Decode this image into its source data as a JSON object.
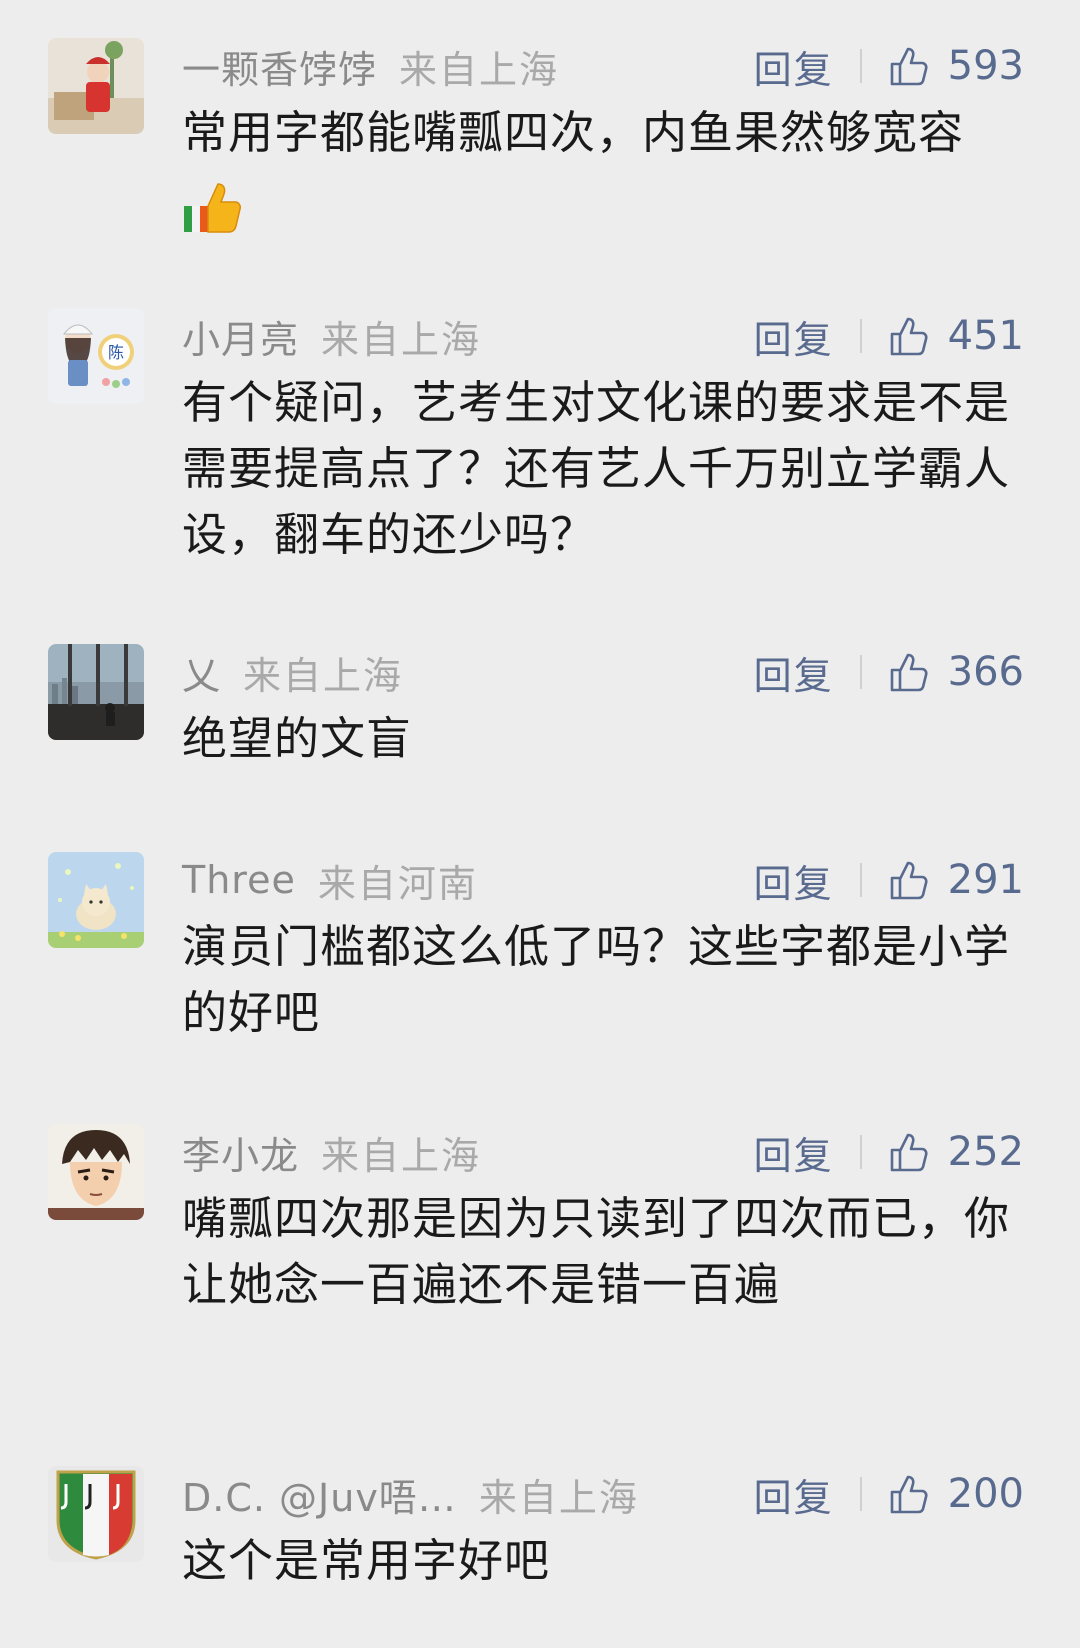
{
  "comments": [
    {
      "username": "一颗香饽饽",
      "location": "来自上海",
      "reply_label": "回复",
      "likes": "593",
      "text": "常用字都能嘴瓢四次，内鱼果然够宽容",
      "emoji": "thumbs-up-emoji"
    },
    {
      "username": "小月亮",
      "location": "来自上海",
      "reply_label": "回复",
      "likes": "451",
      "text": "有个疑问，艺考生对文化课的要求是不是需要提高点了？还有艺人千万别立学霸人设，翻车的还少吗？"
    },
    {
      "username": "乂",
      "location": "来自上海",
      "reply_label": "回复",
      "likes": "366",
      "text": "绝望的文盲"
    },
    {
      "username": "Three",
      "location": "来自河南",
      "reply_label": "回复",
      "likes": "291",
      "text": "演员门槛都这么低了吗？这些字都是小学的好吧"
    },
    {
      "username": "李小龙",
      "location": "来自上海",
      "reply_label": "回复",
      "likes": "252",
      "text": "嘴瓢四次那是因为只读到了四次而已，你让她念一百遍还不是错一百遍"
    },
    {
      "username": "D.C. @Juv唔…",
      "location": "来自上海",
      "reply_label": "回复",
      "likes": "200",
      "text": "这个是常用字好吧"
    }
  ],
  "avatar_badge_text": "陈",
  "colors": {
    "background": "#ededed",
    "link_blue": "#596a8f",
    "username_gray": "#8a8a8a",
    "location_gray": "#a9a9a9",
    "text": "#1a1a1a"
  },
  "icons": {
    "like": "thumbs-up-outline-icon"
  }
}
